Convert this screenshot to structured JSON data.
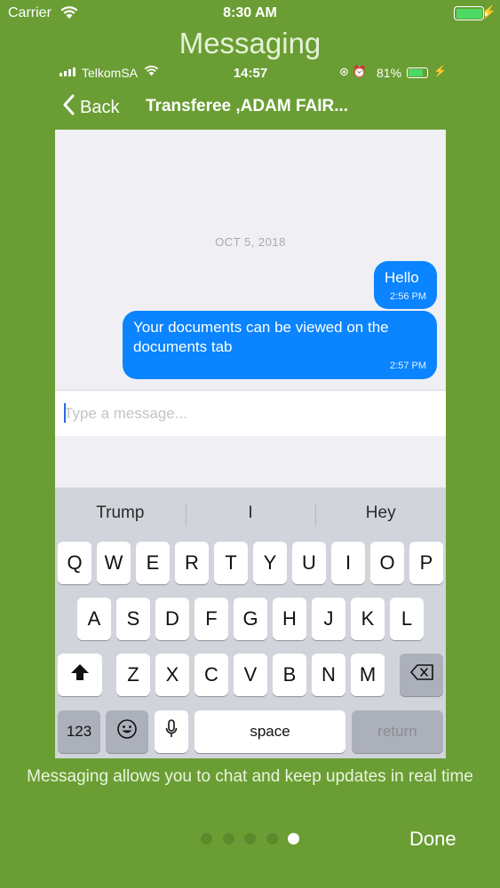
{
  "outer_status": {
    "carrier": "Carrier",
    "time": "8:30 AM",
    "battery_color": "#4cd964"
  },
  "page_title": "Messaging",
  "inner_status": {
    "carrier": "TelkomSA",
    "time": "14:57",
    "battery_pct": "81%"
  },
  "navbar": {
    "back_label": "Back",
    "title": "Transferee ,ADAM FAIR..."
  },
  "chat": {
    "date": "OCT 5, 2018",
    "messages": [
      {
        "text": "Hello",
        "time": "2:56 PM"
      },
      {
        "text": "Your documents can be viewed on the documents tab",
        "time": "2:57 PM"
      }
    ]
  },
  "input": {
    "placeholder": "Type a message..."
  },
  "keyboard": {
    "suggestions": [
      "Trump",
      "I",
      "Hey"
    ],
    "row1": [
      "Q",
      "W",
      "E",
      "R",
      "T",
      "Y",
      "U",
      "I",
      "O",
      "P"
    ],
    "row2": [
      "A",
      "S",
      "D",
      "F",
      "G",
      "H",
      "J",
      "K",
      "L"
    ],
    "row3": [
      "Z",
      "X",
      "C",
      "V",
      "B",
      "N",
      "M"
    ],
    "numbers_key": "123",
    "space_key": "space",
    "return_key": "return"
  },
  "footer": {
    "description": "Messaging allows you to chat and keep updates in real time",
    "page_count": 5,
    "active_page": 4,
    "done_label": "Done"
  },
  "colors": {
    "background": "#6a9e34",
    "bubble": "#0a84ff",
    "keyboard": "#d1d4db"
  }
}
